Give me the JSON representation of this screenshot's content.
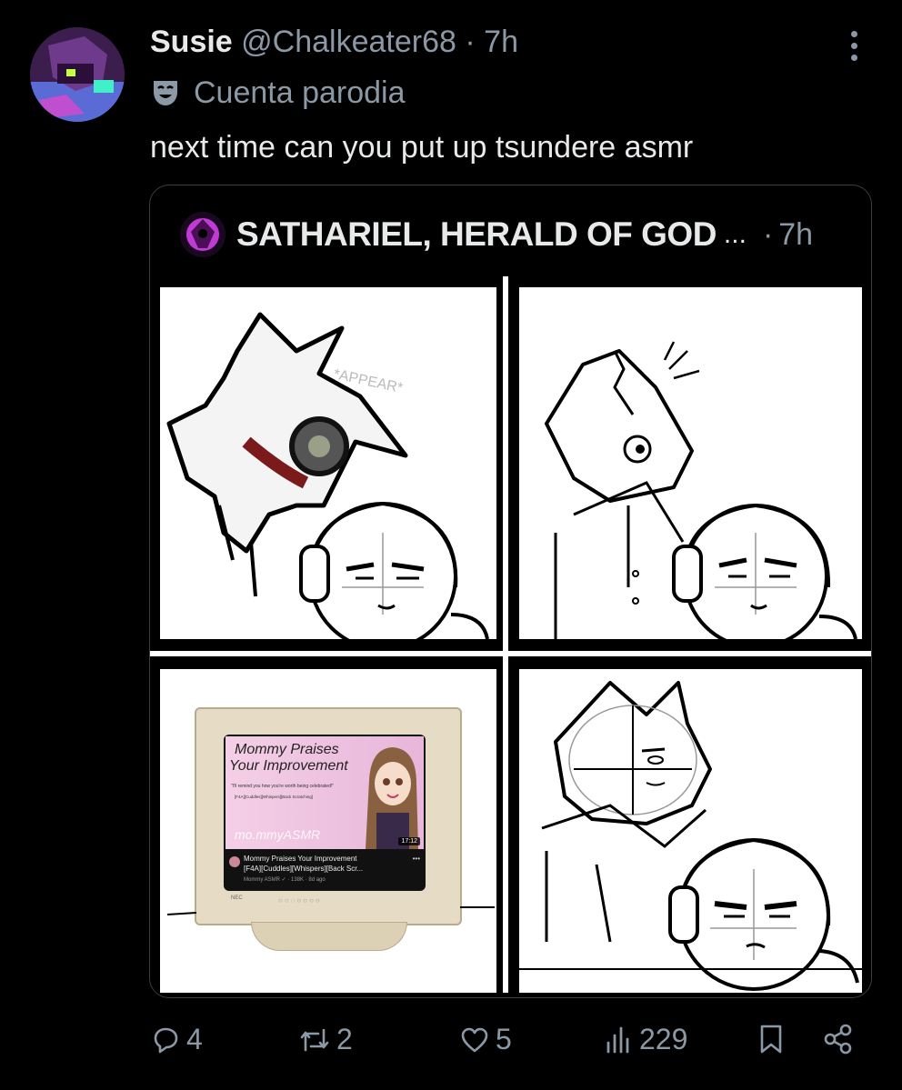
{
  "tweet": {
    "author_name": "Susie",
    "handle": "@Chalkeater68",
    "separator": "·",
    "time": "7h",
    "parody_label": "Cuenta parodia",
    "text": "next time can you put up tsundere asmr",
    "avatar_icon": "profile-avatar"
  },
  "quote": {
    "author_name": "SATHARIEL, HERALD OF GOD",
    "ellipsis": "...",
    "separator": "·",
    "time": "7h"
  },
  "comic": {
    "appear_text": "*APPEAR*",
    "monitor": {
      "thumb_title_line1": "Mommy Praises",
      "thumb_title_line2": "Your Improvement",
      "thumb_quote": "\"I'll remind you how you're worth being celebrated!\"",
      "thumb_tags": "[F4A][Cuddles][Whispers][Back Scratching]",
      "thumb_watermark": "mo.mmyASMR",
      "duration": "17:12",
      "video_title_line1": "Mommy Praises Your Improvement",
      "video_title_line2": "[F4A][Cuddles][Whispers][Back Scr...",
      "video_meta": "Mommy ASMR ✓ · 138K · 8d ago",
      "brand": "NEC"
    }
  },
  "actions": {
    "replies": "4",
    "reposts": "2",
    "likes": "5",
    "views": "229"
  },
  "colors": {
    "background": "#000000",
    "text": "#e7e9ea",
    "secondary": "#8b98a5",
    "border": "#3a3f44"
  }
}
